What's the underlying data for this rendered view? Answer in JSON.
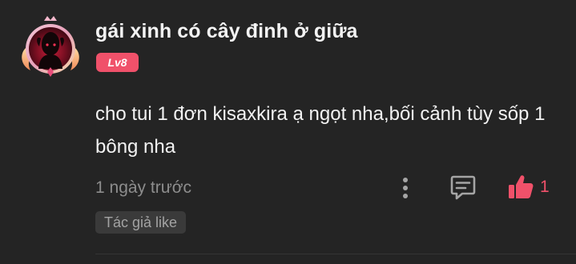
{
  "comment": {
    "username": "gái xinh có cây đinh ở giữa",
    "level_badge": "Lv8",
    "text": "cho tui 1 đơn kisaxkira ạ ngọt nha,bối cảnh tùy sốp 1 bông nha",
    "timestamp": "1 ngày trước",
    "like_count": "1",
    "author_like_tag": "Tác giả like"
  },
  "icons": {
    "avatar": "avatar-with-frame",
    "more": "more-vertical-icon",
    "reply": "comment-reply-icon",
    "like": "thumbs-up-icon"
  },
  "colors": {
    "background": "#242424",
    "accent": "#f0516a",
    "muted_text": "#8d8d8d",
    "tag_background": "#3a3a3a"
  }
}
